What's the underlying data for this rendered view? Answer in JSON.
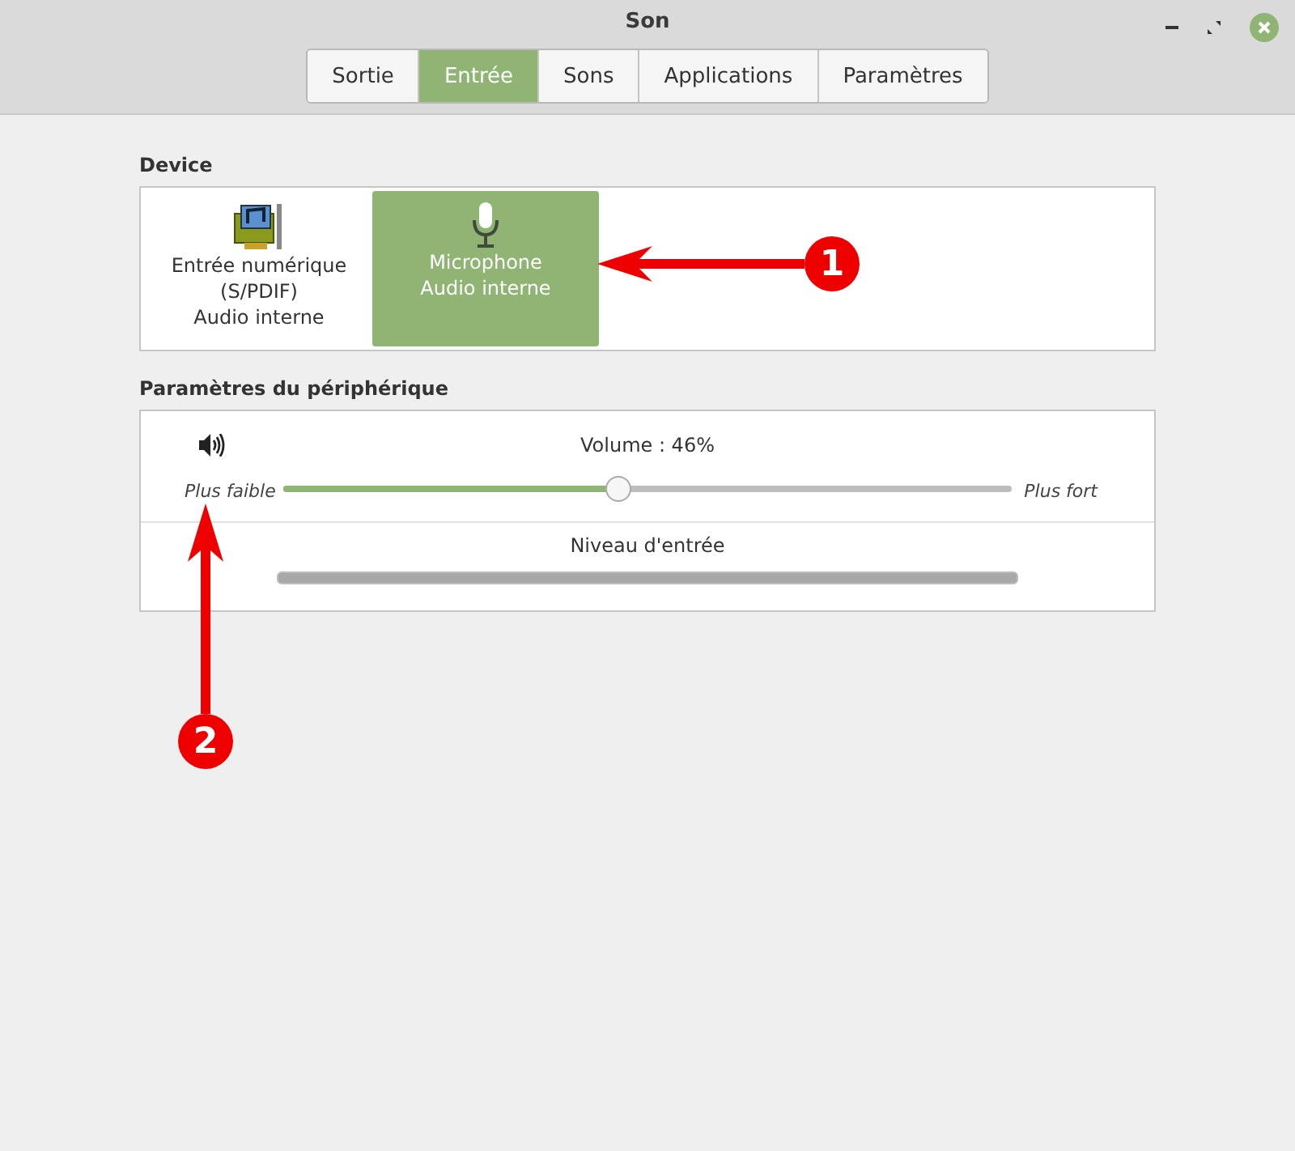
{
  "window": {
    "title": "Son"
  },
  "tabs": [
    {
      "label": "Sortie",
      "selected": false
    },
    {
      "label": "Entrée",
      "selected": true
    },
    {
      "label": "Sons",
      "selected": false
    },
    {
      "label": "Applications",
      "selected": false
    },
    {
      "label": "Paramètres",
      "selected": false
    }
  ],
  "device": {
    "heading": "Device",
    "items": [
      {
        "kind": "card",
        "lines": [
          "Entrée numérique",
          "(S/PDIF)",
          "Audio interne"
        ],
        "selected": false
      },
      {
        "kind": "mic",
        "lines": [
          "Microphone",
          "Audio interne"
        ],
        "selected": true
      }
    ]
  },
  "settings": {
    "heading": "Paramètres du périphérique",
    "volume": {
      "label": "Volume : 46%",
      "low": "Plus faible",
      "high": "Plus fort",
      "level": 0.46
    },
    "input_level": {
      "label": "Niveau d'entrée"
    }
  },
  "annotations": [
    {
      "label": "1"
    },
    {
      "label": "2"
    }
  ]
}
